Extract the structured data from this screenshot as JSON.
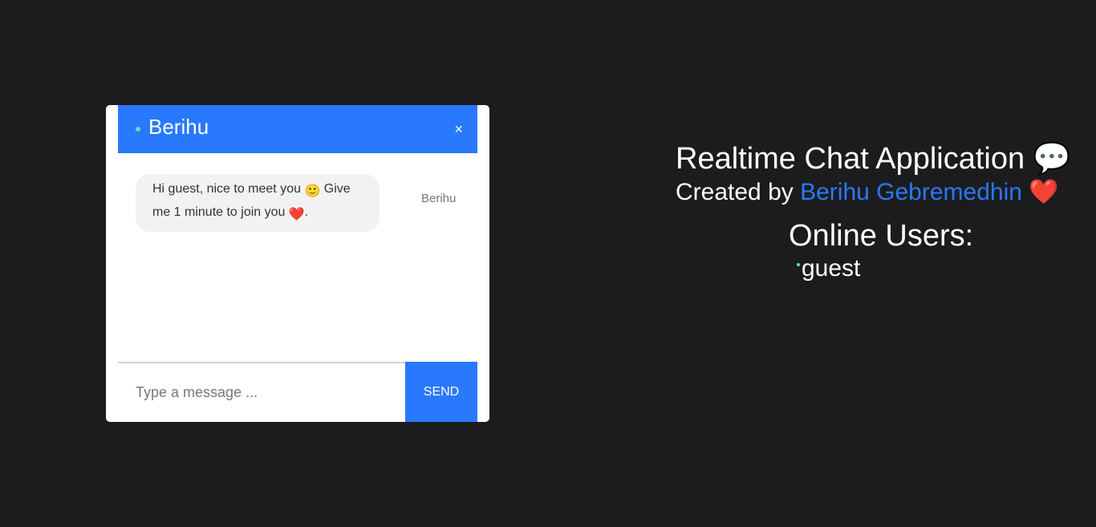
{
  "chat": {
    "header_name": "Berihu",
    "close_label": "×",
    "messages": [
      {
        "text_part1": "Hi guest, nice to meet you",
        "emoji1": "🙂",
        "text_part2": " Give me 1 minute to join you",
        "emoji2": "❤️",
        "text_part3": ".",
        "sender": "Berihu"
      }
    ],
    "input_placeholder": "Type a message ...",
    "send_label": "SEND"
  },
  "info": {
    "title": "Realtime Chat Application",
    "title_icon": "💬",
    "credit_prefix": "Created by",
    "author": "Berihu Gebremedhin",
    "credit_icon": "❤️",
    "online_title": "Online Users:",
    "online_users": [
      "guest"
    ]
  },
  "colors": {
    "background": "#1c1c1e",
    "accent": "#2979ff",
    "online_status": "#5ce0c0",
    "bubble": "#f2f2f2"
  }
}
